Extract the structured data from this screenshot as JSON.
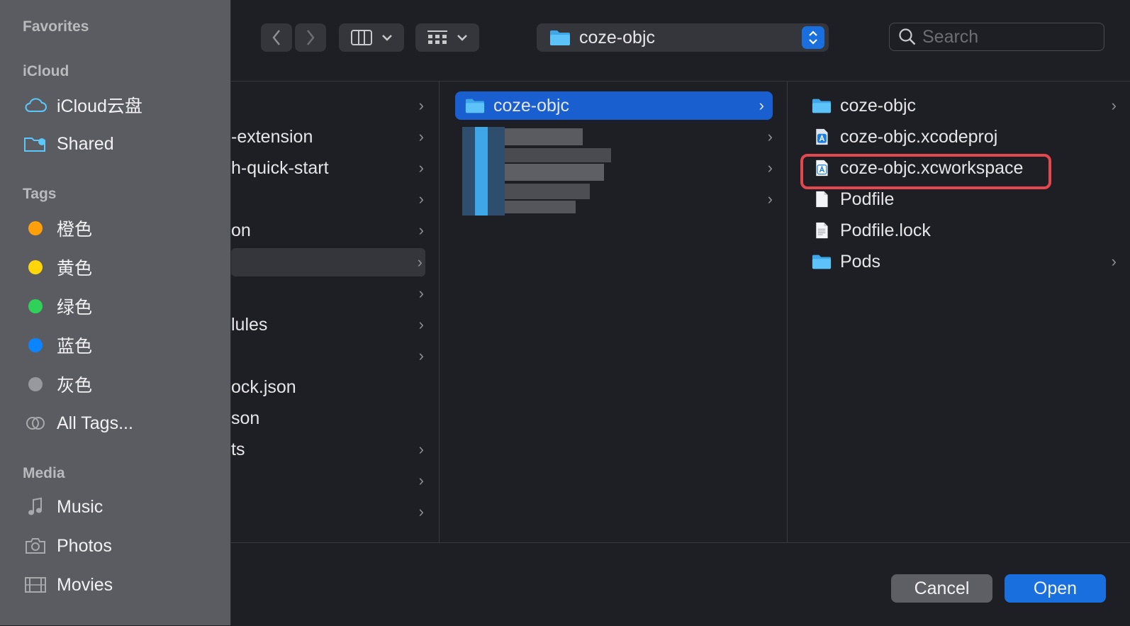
{
  "sidebar": {
    "favorites_label": "Favorites",
    "icloud_label": "iCloud",
    "icloud_items": [
      {
        "label": "iCloud云盘",
        "icon": "cloud-icon"
      },
      {
        "label": "Shared",
        "icon": "shared-folder-icon"
      }
    ],
    "tags_label": "Tags",
    "tags": [
      {
        "label": "橙色",
        "color": "#ff9f0a"
      },
      {
        "label": "黄色",
        "color": "#ffd60a"
      },
      {
        "label": "绿色",
        "color": "#30d158"
      },
      {
        "label": "蓝色",
        "color": "#0a84ff"
      },
      {
        "label": "灰色",
        "color": "#98989d"
      }
    ],
    "all_tags_label": "All Tags...",
    "media_label": "Media",
    "media_items": [
      {
        "label": "Music",
        "icon": "music-note-icon"
      },
      {
        "label": "Photos",
        "icon": "camera-icon"
      },
      {
        "label": "Movies",
        "icon": "film-icon"
      }
    ]
  },
  "toolbar": {
    "path_label": "coze-objc",
    "search_placeholder": "Search"
  },
  "column1": {
    "rows": [
      {
        "label": "",
        "chevron": true
      },
      {
        "label": "-extension",
        "chevron": true
      },
      {
        "label": "h-quick-start",
        "chevron": true
      },
      {
        "label": "",
        "chevron": true
      },
      {
        "label": "on",
        "chevron": true
      },
      {
        "label": "",
        "chevron": true,
        "selected": true
      },
      {
        "label": "",
        "chevron": true
      },
      {
        "label": "lules",
        "chevron": true
      },
      {
        "label": "",
        "chevron": true
      },
      {
        "label": "ock.json",
        "chevron": false
      },
      {
        "label": "son",
        "chevron": false
      },
      {
        "label": "ts",
        "chevron": true
      },
      {
        "label": "",
        "chevron": true
      },
      {
        "label": "",
        "chevron": true
      }
    ]
  },
  "column2": {
    "selected_label": "coze-objc"
  },
  "column3": {
    "rows": [
      {
        "label": "coze-objc",
        "icon": "folder-icon",
        "chevron": true
      },
      {
        "label": "coze-objc.xcodeproj",
        "icon": "xcode-project-icon",
        "chevron": false
      },
      {
        "label": "coze-objc.xcworkspace",
        "icon": "xcode-workspace-icon",
        "chevron": false
      },
      {
        "label": "Podfile",
        "icon": "document-icon",
        "chevron": false
      },
      {
        "label": "Podfile.lock",
        "icon": "text-document-icon",
        "chevron": false
      },
      {
        "label": "Pods",
        "icon": "folder-icon",
        "chevron": true
      }
    ]
  },
  "footer": {
    "cancel_label": "Cancel",
    "open_label": "Open"
  }
}
